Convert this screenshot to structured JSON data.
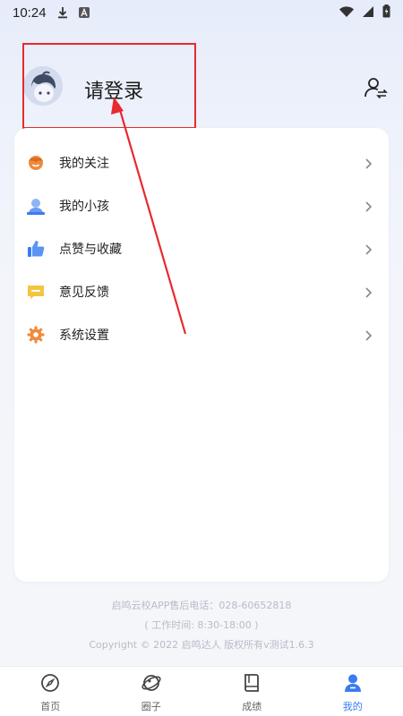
{
  "status_bar": {
    "time": "10:24",
    "icons": [
      "download-icon",
      "a-notification-icon",
      "wifi-icon",
      "signal-icon",
      "battery-icon"
    ]
  },
  "header": {
    "login_text": "请登录",
    "avatar": "avatar-cartoon-boy",
    "switch_icon": "switch-user-icon"
  },
  "menu": {
    "items": [
      {
        "label": "我的关注",
        "icon": "follow-icon",
        "color": "#f08a3c"
      },
      {
        "label": "我的小孩",
        "icon": "child-icon",
        "color": "#6b9bf2"
      },
      {
        "label": "点赞与收藏",
        "icon": "thumbs-up-icon",
        "color": "#3a7bf2"
      },
      {
        "label": "意见反馈",
        "icon": "feedback-icon",
        "color": "#f5c542"
      },
      {
        "label": "系统设置",
        "icon": "gear-icon",
        "color": "#f08a3c"
      }
    ]
  },
  "footer": {
    "line1": "启鸣云校APP售后电话：028-60652818",
    "line2": "( 工作时间: 8:30-18:00 )",
    "line3": "Copyright © 2022 启鸣达人 版权所有v测试1.6.3"
  },
  "tabbar": {
    "active": "我的",
    "tabs": [
      {
        "label": "首页",
        "icon": "compass-icon"
      },
      {
        "label": "圈子",
        "icon": "circle-icon"
      },
      {
        "label": "成绩",
        "icon": "book-icon"
      },
      {
        "label": "我的",
        "icon": "profile-icon"
      }
    ]
  },
  "colors": {
    "accent": "#3a7bf2",
    "annotation_red": "#e8292e"
  }
}
